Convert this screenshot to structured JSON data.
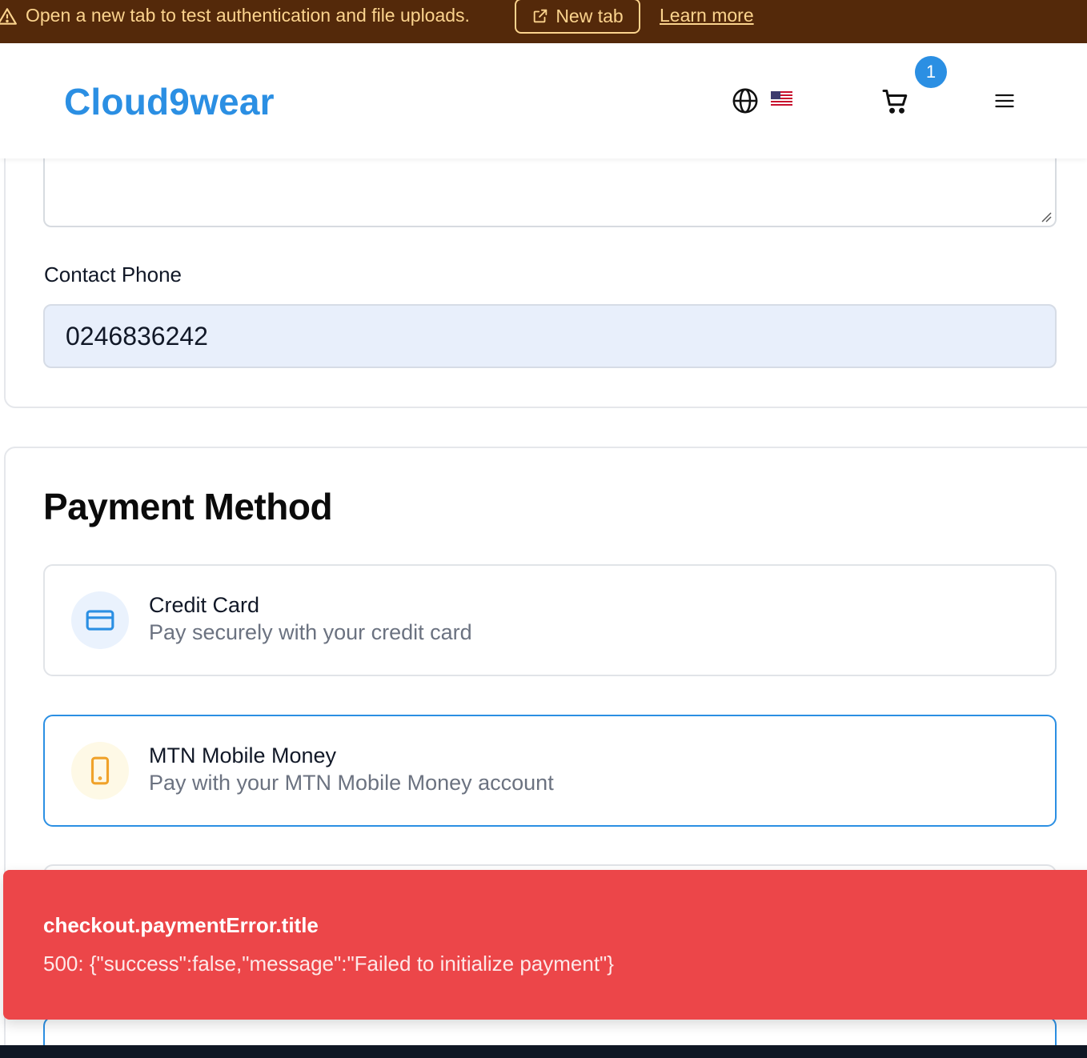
{
  "banner": {
    "message": "Open a new tab to test authentication and file uploads.",
    "new_tab_label": "New tab",
    "learn_more_label": "Learn more",
    "icons": {
      "warning": "warning-triangle-icon",
      "external": "external-link-icon"
    },
    "colors": {
      "background": "#54290a",
      "text": "#fbd38d"
    }
  },
  "header": {
    "logo": "Cloud9wear",
    "cart_count": "1",
    "icons": {
      "language": "globe-icon",
      "flag": "us-flag-icon",
      "cart": "cart-icon",
      "menu": "hamburger-menu-icon"
    },
    "colors": {
      "brand": "#2b8fe3"
    }
  },
  "contact": {
    "phone_label": "Contact Phone",
    "phone_value": "0246836242"
  },
  "payment": {
    "title": "Payment Method",
    "options": [
      {
        "title": "Credit Card",
        "description": "Pay securely with your credit card",
        "icon": "credit-card-icon",
        "selected": false
      },
      {
        "title": "MTN Mobile Money",
        "description": "Pay with your MTN Mobile Money account",
        "icon": "mobile-phone-icon",
        "selected": true
      }
    ]
  },
  "toast": {
    "title": "checkout.paymentError.title",
    "message": "500: {\"success\":false,\"message\":\"Failed to initialize payment\"}",
    "colors": {
      "background": "#ec4649"
    }
  }
}
